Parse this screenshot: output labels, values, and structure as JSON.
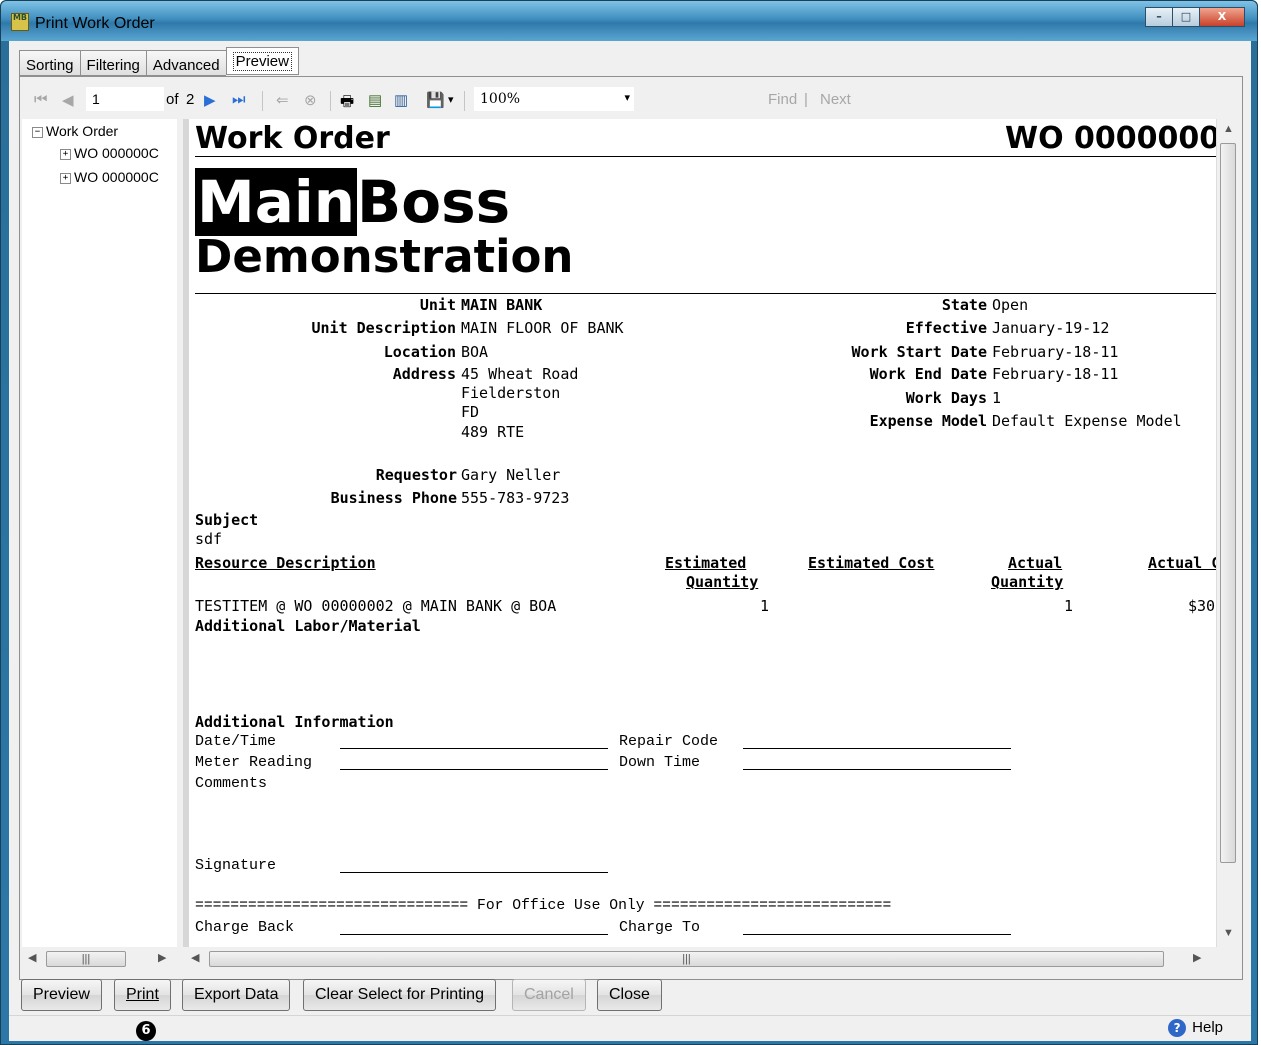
{
  "window": {
    "title": "Print Work Order",
    "icon_text": "MB",
    "minimize": "–",
    "maximize": "□",
    "close": "X"
  },
  "tabs": [
    {
      "label": "Sorting"
    },
    {
      "label": "Filtering"
    },
    {
      "label": "Advanced"
    },
    {
      "label": "Preview"
    }
  ],
  "toolbar": {
    "first": "⏮",
    "prev": "◀",
    "page_value": "1",
    "of_label": "of",
    "page_total": "2",
    "next": "▶",
    "last": "⏭",
    "back": "⇐",
    "stop": "⊗",
    "print": "🖶",
    "page_setup": "▤",
    "view": "▥",
    "export": "💾",
    "export_caret": "▾",
    "zoom": "100%",
    "zoom_caret": "▾",
    "find": "Find",
    "find_sep": "|",
    "next_label": "Next"
  },
  "tree": {
    "root": "Work Order",
    "children": [
      "WO 000000C",
      "WO 000000C"
    ]
  },
  "report": {
    "title": "Work Order",
    "wo_number": "WO 0000000",
    "logo_main": "Main",
    "logo_boss": "Boss",
    "logo_demo": "Demonstration",
    "left_fields": [
      {
        "label": "Unit",
        "value": "MAIN BANK"
      },
      {
        "label": "Unit Description",
        "value": "MAIN FLOOR OF BANK"
      },
      {
        "label": "Location",
        "value": "BOA"
      },
      {
        "label": "Address",
        "value": "45 Wheat Road"
      }
    ],
    "address_lines": [
      "Fielderston",
      "FD",
      "489 RTE"
    ],
    "right_fields": [
      {
        "label": "State",
        "value": "Open"
      },
      {
        "label": "Effective",
        "value": "January-19-12"
      },
      {
        "label": "Work Start Date",
        "value": "February-18-11"
      },
      {
        "label": "Work End Date",
        "value": "February-18-11"
      },
      {
        "label": "Work Days",
        "value": "1"
      },
      {
        "label": "Expense Model",
        "value": "Default Expense Model"
      }
    ],
    "requestor_label": "Requestor",
    "requestor": "Gary Neller",
    "phone_label": "Business Phone",
    "phone": "555-783-9723",
    "subject_label": "Subject",
    "subject": "sdf",
    "table_headers": {
      "resource": "Resource Description",
      "est_qty_1": "Estimated",
      "est_qty_2": "Quantity",
      "est_cost": "Estimated Cost",
      "act_qty_1": "Actual",
      "act_qty_2": "Quantity",
      "act_cost": "Actual C"
    },
    "row": {
      "resource": "TESTITEM @ WO 00000002 @ MAIN BANK @ BOA",
      "est_qty": "1",
      "act_qty": "1",
      "act_cost": "$30"
    },
    "additional_labor": "Additional Labor/Material",
    "additional_info": "Additional Information",
    "form": {
      "date_time": "Date/Time",
      "repair_code": "Repair Code",
      "meter_reading": "Meter Reading",
      "down_time": "Down Time",
      "comments": "Comments",
      "signature": "Signature",
      "office_use": "=============================== For Office Use Only ===========================",
      "charge_back": "Charge Back",
      "charge_to": "Charge To"
    }
  },
  "buttons": {
    "preview": "Preview",
    "print": "Print",
    "export": "Export Data",
    "clear": "Clear Select for Printing",
    "cancel": "Cancel",
    "close": "Close"
  },
  "status": {
    "badge": "6",
    "help": "Help",
    "help_icon": "?"
  }
}
